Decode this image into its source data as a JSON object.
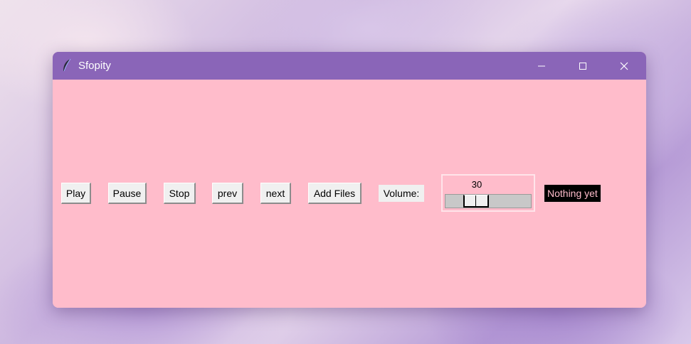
{
  "window": {
    "title": "Sfopity",
    "icon": "feather-icon",
    "controls": [
      "minimize-icon",
      "maximize-icon",
      "close-icon"
    ]
  },
  "controls": {
    "play_label": "Play",
    "pause_label": "Pause",
    "stop_label": "Stop",
    "prev_label": "prev",
    "next_label": "next",
    "add_files_label": "Add Files"
  },
  "volume": {
    "label": "Volume:",
    "value": "30",
    "min": 0,
    "max": 100
  },
  "status": {
    "text": "Nothing yet"
  },
  "colors": {
    "titlebar": "#8a65b8",
    "content_background": "#ffbccb",
    "button_face": "#f0f0f0",
    "status_background": "#000000",
    "status_text": "#ffbccb"
  }
}
